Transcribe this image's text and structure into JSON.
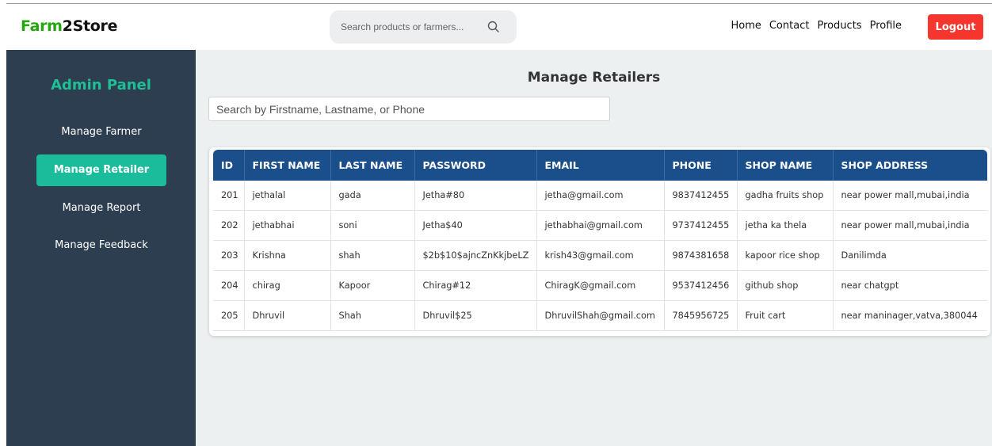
{
  "brand": {
    "part1": "Farm",
    "part2": "2Store"
  },
  "header_search": {
    "placeholder": "Search products or farmers..."
  },
  "nav": {
    "links": [
      "Home",
      "Contact",
      "Products",
      "Profile"
    ],
    "logout_label": "Logout"
  },
  "sidebar": {
    "title": "Admin Panel",
    "items": [
      {
        "label": "Manage Farmer",
        "active": false
      },
      {
        "label": "Manage Retailer",
        "active": true
      },
      {
        "label": "Manage Report",
        "active": false
      },
      {
        "label": "Manage Feedback",
        "active": false
      }
    ]
  },
  "main": {
    "title": "Manage Retailers",
    "search_placeholder": "Search by Firstname, Lastname, or Phone",
    "table": {
      "columns": [
        "ID",
        "FIRST NAME",
        "LAST NAME",
        "PASSWORD",
        "EMAIL",
        "PHONE",
        "SHOP NAME",
        "SHOP ADDRESS"
      ],
      "rows": [
        [
          "201",
          "jethalal",
          "gada",
          "Jetha#80",
          "jetha@gmail.com",
          "9837412455",
          "gadha fruits shop",
          "near power mall,mubai,india"
        ],
        [
          "202",
          "jethabhai",
          "soni",
          "Jetha$40",
          "jethabhai@gmail.com",
          "9737412455",
          "jetha ka thela",
          "near power mall,mubai,india"
        ],
        [
          "203",
          "Krishna",
          "shah",
          "$2b$10$ajncZnKkjbeLZ",
          "krish43@gmail.com",
          "9874381658",
          "kapoor rice shop",
          "Danilimda"
        ],
        [
          "204",
          "chirag",
          "Kapoor",
          "Chirag#12",
          "ChiragK@gmail.com",
          "9537412456",
          "github shop",
          "near chatgpt"
        ],
        [
          "205",
          "Dhruvil",
          "Shah",
          "Dhruvil$25",
          "DhruvilShah@gmail.com",
          "7845956725",
          "Fruit cart",
          "near maninager,vatva,380044"
        ]
      ]
    }
  },
  "colors": {
    "brand_green": "#22a80c",
    "sidebar_bg": "#2d3e50",
    "accent_teal": "#1abc9c",
    "table_header": "#1a4f8c",
    "logout_red": "#f4362e"
  },
  "icons": {
    "search": "search-icon"
  }
}
